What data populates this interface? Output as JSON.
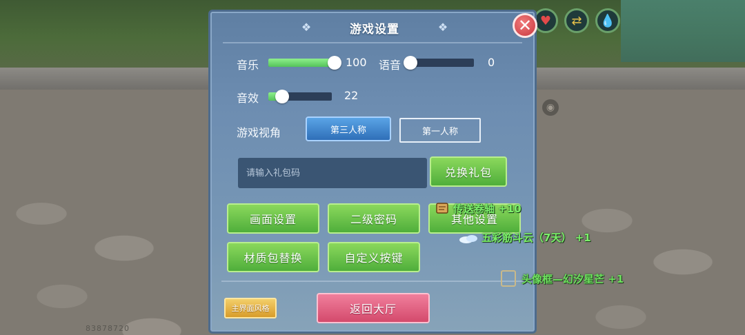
{
  "scene": {
    "player_id": "83878720"
  },
  "hud": {
    "icons": [
      "heart-icon",
      "swap-icon",
      "water-drop-icon",
      "eye-icon"
    ]
  },
  "panel": {
    "title": "游戏设置",
    "close_icon": "close-icon",
    "music": {
      "label": "音乐",
      "value": 100,
      "value_text": "100"
    },
    "voice": {
      "label": "语音",
      "value": 0,
      "value_text": "0"
    },
    "sfx": {
      "label": "音效",
      "value": 22,
      "value_text": "22"
    },
    "view": {
      "label": "游戏视角",
      "options": [
        "第三人称",
        "第一人称"
      ],
      "selected": "第三人称"
    },
    "gift": {
      "placeholder": "请输入礼包码",
      "redeem_label": "兑换礼包"
    },
    "buttons": {
      "graphics": "画面设置",
      "second_password": "二级密码",
      "other": "其他设置",
      "texture_pack": "材质包替换",
      "custom_keys": "自定义按键"
    },
    "main_style_label": "主界面风格",
    "back_label": "返回大厅"
  },
  "rewards": [
    {
      "text": "传送卷轴 +10",
      "icon": "scroll-icon"
    },
    {
      "text": "五彩筋斗云（7天） +1",
      "icon": "cloud-icon"
    },
    {
      "text": "头像框—幻汐星芒 +1",
      "icon": "frame-icon"
    }
  ],
  "colors": {
    "panel": "#6d8db1",
    "slider_fill": "#55c25a",
    "button_green": "#4fae3b",
    "button_pink": "#d44a6c",
    "button_gold": "#d89c2a",
    "reward_text": "#7cf06a"
  }
}
